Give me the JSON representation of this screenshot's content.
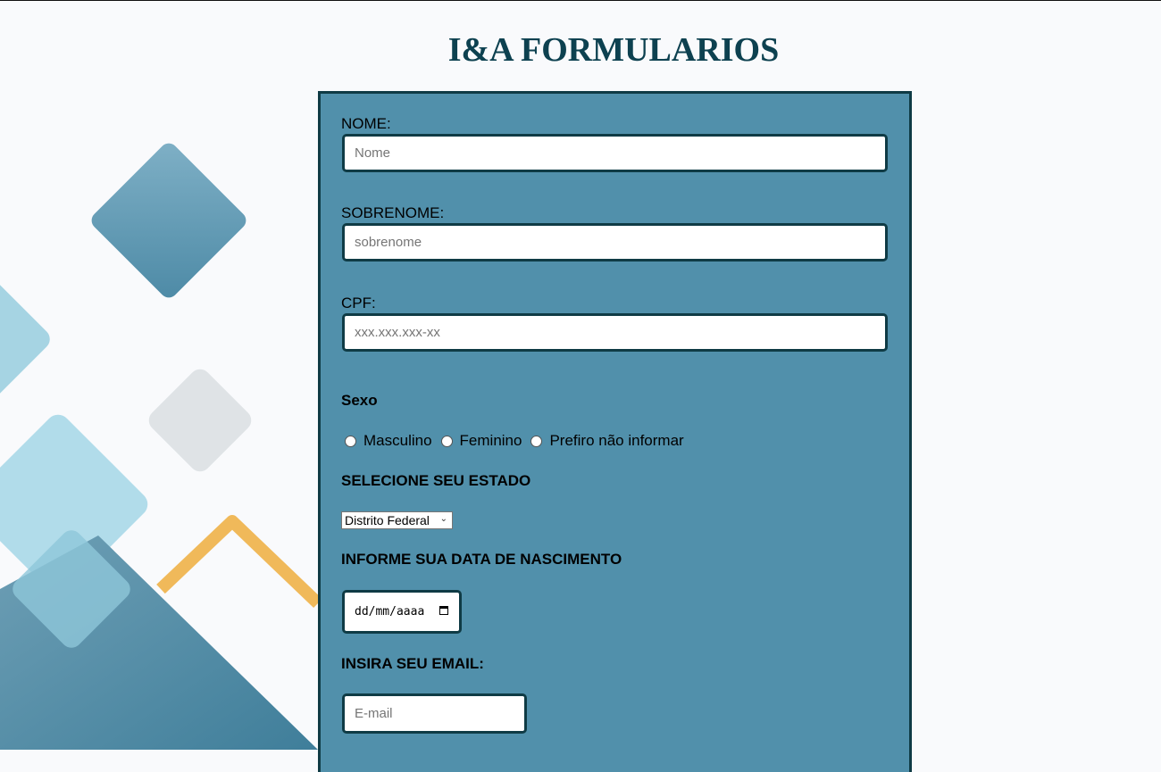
{
  "page": {
    "title": "I&A FORMULARIOS"
  },
  "form": {
    "nome": {
      "label": "NOME:",
      "placeholder": "Nome"
    },
    "sobrenome": {
      "label": "SOBRENOME:",
      "placeholder": "sobrenome"
    },
    "cpf": {
      "label": "CPF:",
      "placeholder": "xxx.xxx.xxx-xx"
    },
    "sexo": {
      "label": "Sexo",
      "options": [
        "Masculino",
        "Feminino",
        "Prefiro não informar"
      ]
    },
    "estado": {
      "label": "SELECIONE SEU ESTADO",
      "selected": "Distrito Federal"
    },
    "nascimento": {
      "label": "INFORME SUA DATA DE NASCIMENTO",
      "placeholder": "dd/mm/aaaa"
    },
    "email": {
      "label": "INSIRA SEU EMAIL:",
      "placeholder": "E-mail"
    }
  },
  "colors": {
    "panel": "#5190ab",
    "border": "#0f3b45",
    "title": "#0d4150",
    "background": "#f9fafc"
  },
  "icons": {
    "select_arrow": "chevron-down-icon",
    "date_picker": "calendar-icon"
  }
}
